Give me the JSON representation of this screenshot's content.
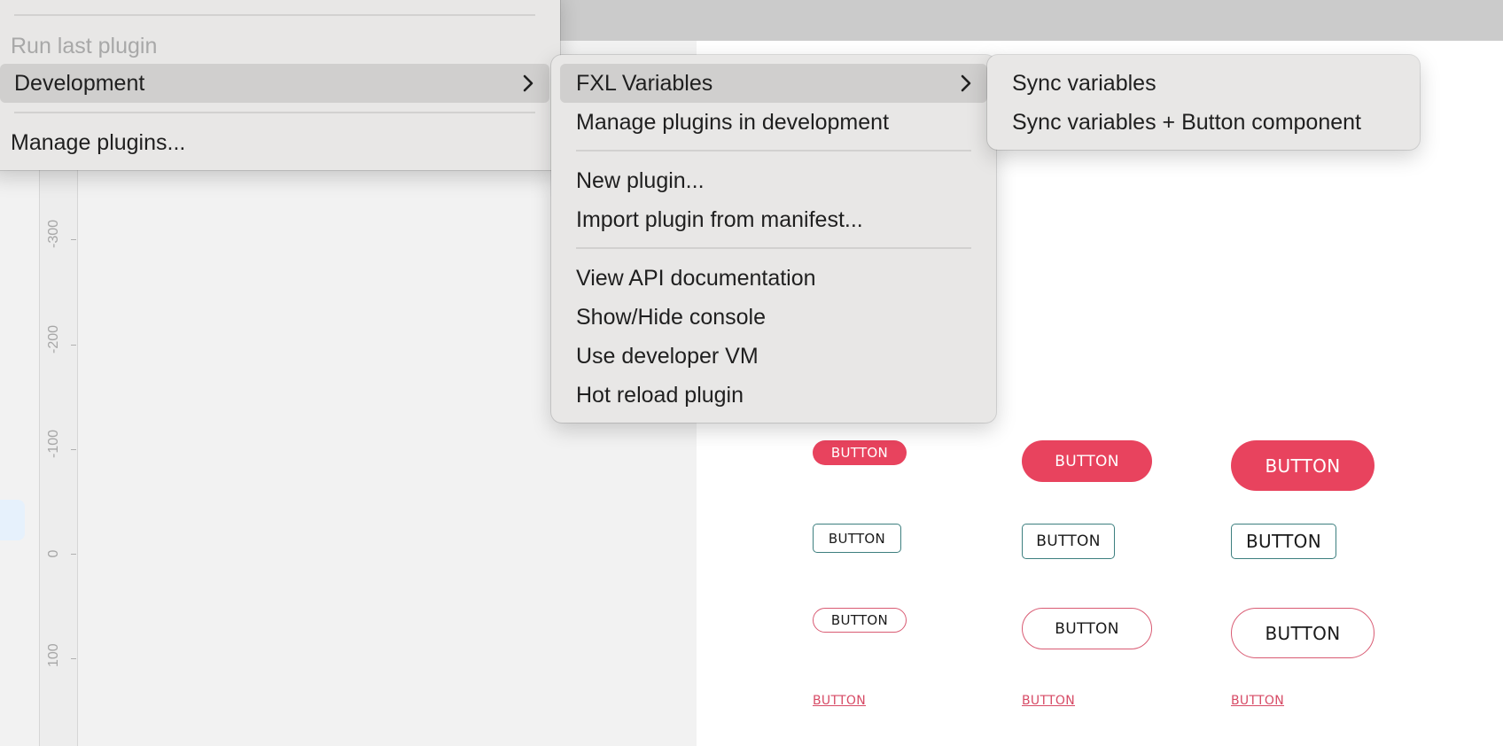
{
  "plugins_menu": {
    "items": [
      {
        "label": "Run last plugin",
        "disabled": true
      },
      {
        "label": "Development",
        "highlighted": true,
        "submenu": true
      },
      {
        "label": "Manage plugins..."
      }
    ]
  },
  "development_menu": {
    "items": [
      {
        "label": "FXL Variables",
        "highlighted": true,
        "submenu": true
      },
      {
        "label": "Manage plugins in development"
      },
      {
        "label": "New plugin..."
      },
      {
        "label": "Import plugin from manifest..."
      },
      {
        "label": "View API documentation"
      },
      {
        "label": "Show/Hide console"
      },
      {
        "label": "Use developer VM"
      },
      {
        "label": "Hot reload plugin"
      }
    ]
  },
  "fxl_menu": {
    "items": [
      {
        "label": "Sync variables"
      },
      {
        "label": "Sync variables + Button component"
      }
    ]
  },
  "ruler": {
    "labels": [
      "-300",
      "-200",
      "-100",
      "0",
      "100"
    ]
  },
  "canvas": {
    "button_label": "BUTTON",
    "accent_color": "#e8435e",
    "outline_color": "#3d7f7f"
  }
}
